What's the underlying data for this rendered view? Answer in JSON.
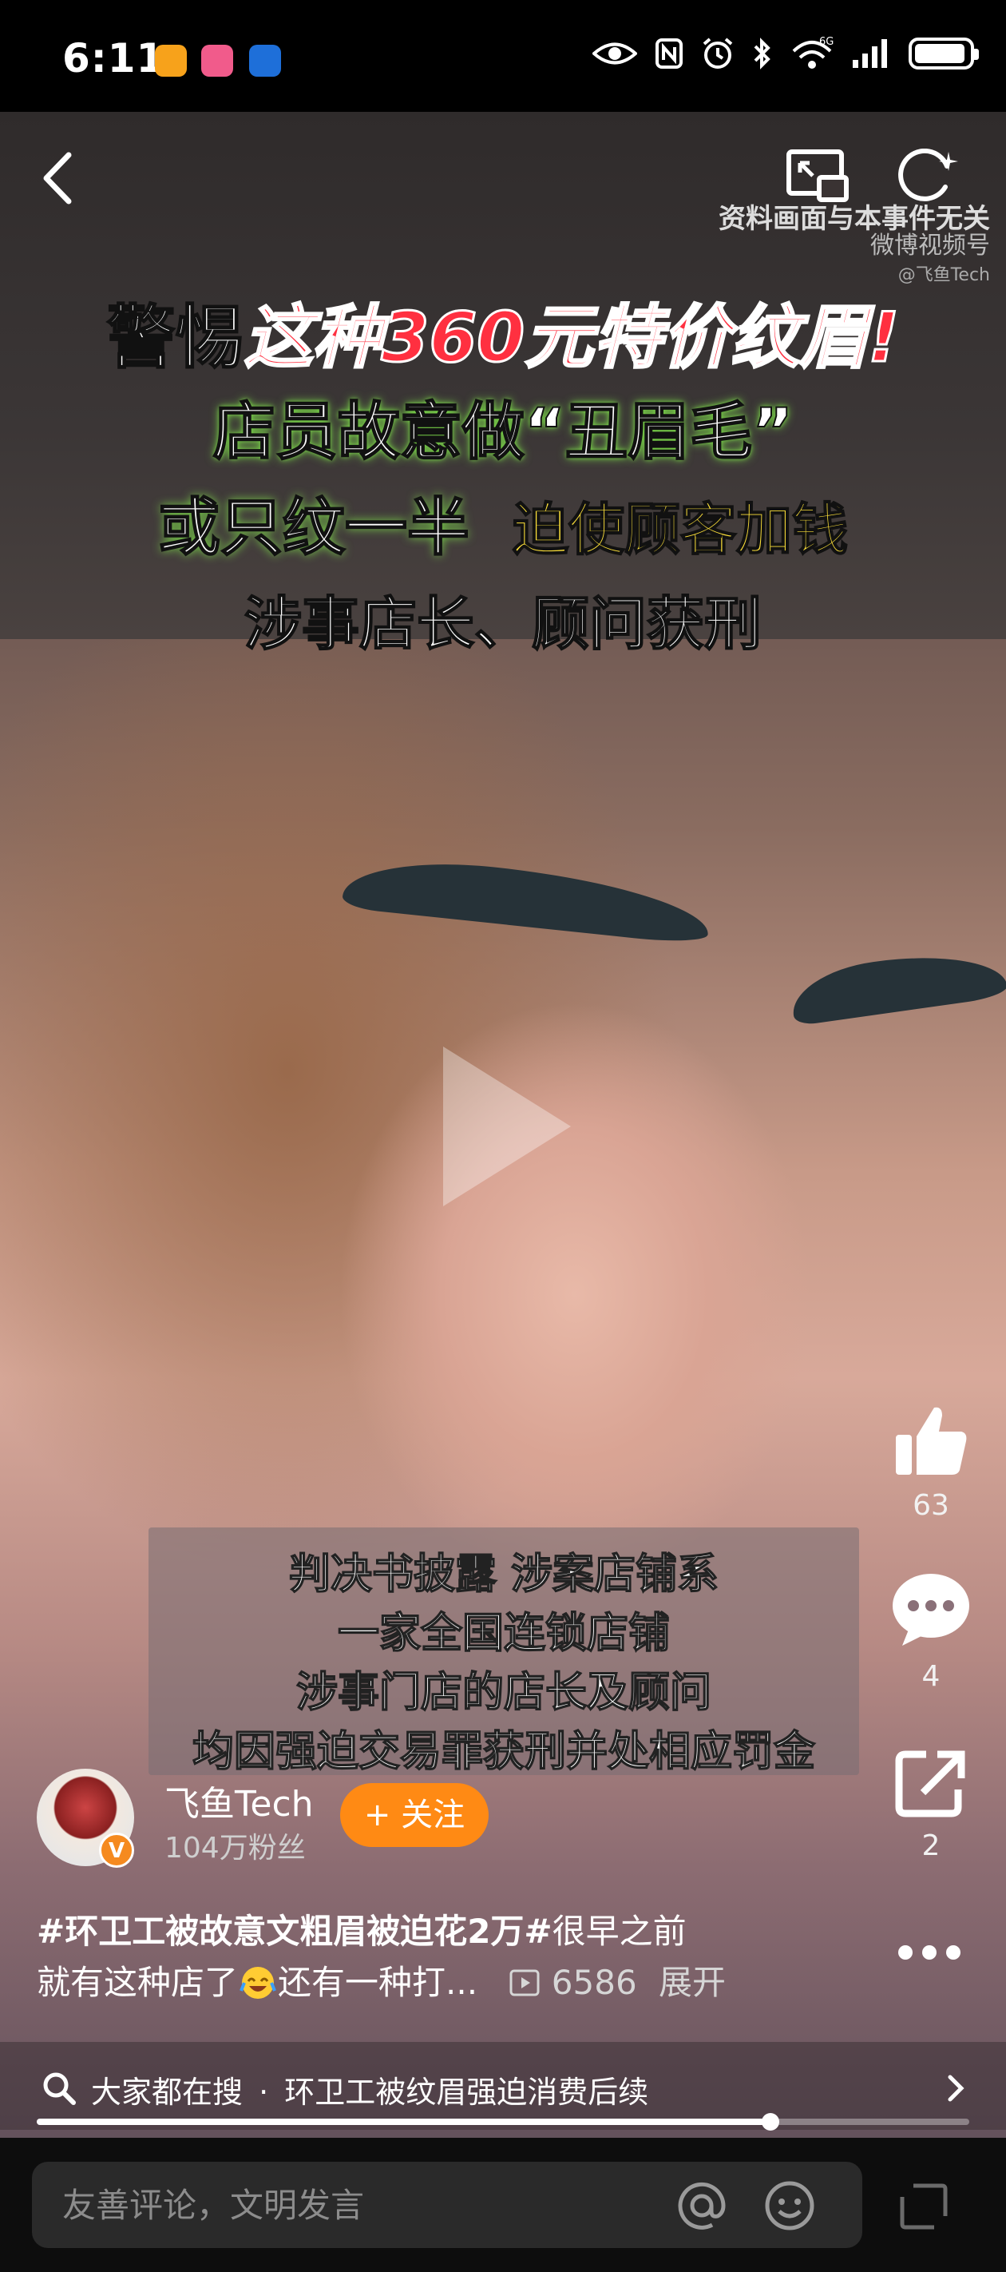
{
  "status_bar": {
    "time": "6:11",
    "signal_label": "6G"
  },
  "video": {
    "banner": {
      "line1_prefix": "警惕",
      "line1_highlight": "这种360元特价纹眉!",
      "line2": "店员故意做“丑眉毛”",
      "line3_left": "或只纹一半",
      "line3_right": "迫使顾客加钱",
      "line4": "涉事店长、顾问获刑"
    },
    "watermark": {
      "disclaimer": "资料画面与本事件无关",
      "source": "微博视频号",
      "handle": "@飞鱼Tech"
    },
    "subtitles": [
      "判决书披露 涉案店铺系",
      "一家全国连锁店铺",
      "涉事门店的店长及顾问",
      "均因强迫交易罪获刑并处相应罚金"
    ]
  },
  "actions": {
    "like_count": "63",
    "comment_count": "4",
    "share_count": "2"
  },
  "author": {
    "name": "飞鱼Tech",
    "fans": "104万粉丝",
    "follow_label": "+ 关注",
    "verified_badge": "V"
  },
  "description": {
    "line1_tag": "#环卫工被故意文粗眉被迫花2万#",
    "line1_rest": "很早之前",
    "line2_text": "就有这种店了",
    "line2_after_emoji": "还有一种打...",
    "play_count": "6586",
    "expand_label": "展开"
  },
  "search": {
    "prefix": "大家都在搜",
    "separator": "·",
    "query": "环卫工被纹眉强迫消费后续"
  },
  "progress": {
    "fraction": 0.787
  },
  "comment": {
    "placeholder": "友善评论，文明发言"
  },
  "colors": {
    "accent_orange": "#ff8a14",
    "banner_red": "#ff3040",
    "banner_yellow": "#ffe23a",
    "banner_green_glow": "#7ee04a"
  }
}
